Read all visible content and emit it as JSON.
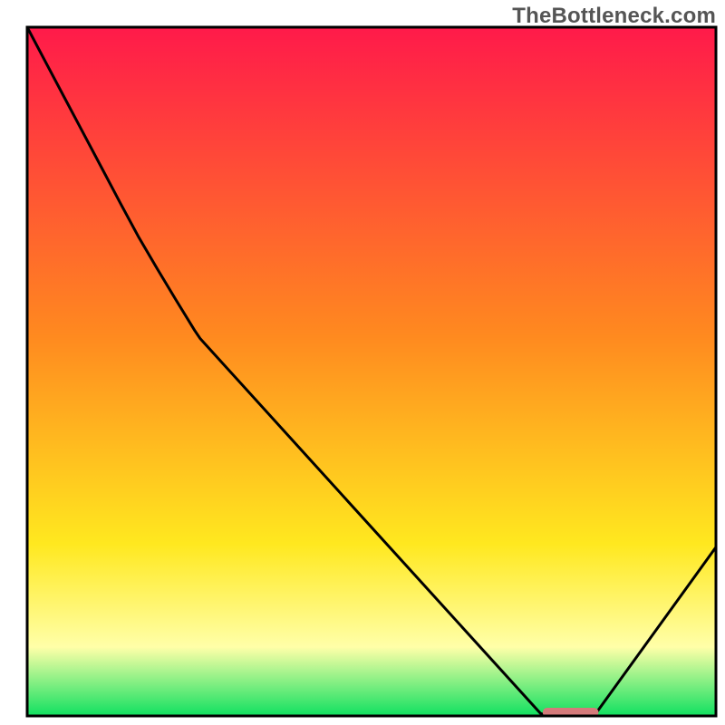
{
  "watermark": "TheBottleneck.com",
  "colors": {
    "gradient_top": "#ff1a4a",
    "gradient_mid1": "#ff8a1f",
    "gradient_mid2": "#ffe81f",
    "gradient_pale": "#ffffa8",
    "gradient_green": "#10e060",
    "curve": "#000000",
    "marker": "#d47a7a",
    "frame": "#000000"
  },
  "chart_data": {
    "type": "line",
    "title": "",
    "xlabel": "",
    "ylabel": "",
    "x": [
      0.0,
      0.027,
      0.054,
      0.081,
      0.108,
      0.135,
      0.162,
      0.189,
      0.216,
      0.243,
      0.251,
      0.745,
      0.755,
      0.823,
      1.0
    ],
    "y": [
      1.0,
      0.949,
      0.898,
      0.847,
      0.796,
      0.745,
      0.695,
      0.649,
      0.604,
      0.56,
      0.548,
      0.004,
      0.0,
      0.0,
      0.245
    ],
    "xlim": [
      0,
      1
    ],
    "ylim": [
      0,
      1
    ],
    "marker_band": {
      "x0": 0.755,
      "x1": 0.823,
      "y": 0.0
    },
    "description": "Black curve descending from top-left corner with slight inflection near x≈0.25, reaching zero near x≈0.76, flat until x≈0.82, then rising. Short pink marker segment on the flat minimum."
  }
}
